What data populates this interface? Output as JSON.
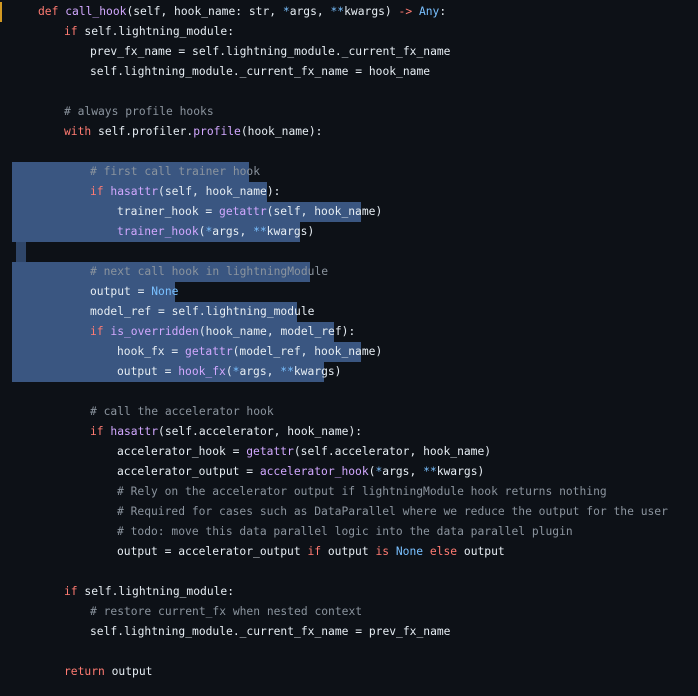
{
  "code": {
    "lines": [
      {
        "indent": 1,
        "tokens": [
          [
            "kw",
            "def "
          ],
          [
            "fn",
            "call_hook"
          ],
          [
            "pl",
            "(self, hook_name: str, "
          ],
          [
            "bi",
            "*"
          ],
          [
            "pl",
            "args, "
          ],
          [
            "bi",
            "**"
          ],
          [
            "pl",
            "kwargs) "
          ],
          [
            "kw",
            "-> "
          ],
          [
            "bi",
            "Any"
          ],
          [
            "pl",
            ":"
          ]
        ]
      },
      {
        "indent": 2,
        "tokens": [
          [
            "kw",
            "if "
          ],
          [
            "pl",
            "self.lightning_module:"
          ]
        ]
      },
      {
        "indent": 3,
        "tokens": [
          [
            "pl",
            "prev_fx_name = self.lightning_module._current_fx_name"
          ]
        ]
      },
      {
        "indent": 3,
        "tokens": [
          [
            "pl",
            "self.lightning_module._current_fx_name = hook_name"
          ]
        ]
      },
      {
        "indent": 0,
        "tokens": []
      },
      {
        "indent": 2,
        "tokens": [
          [
            "cm",
            "# always profile hooks"
          ]
        ]
      },
      {
        "indent": 2,
        "tokens": [
          [
            "kw",
            "with "
          ],
          [
            "pl",
            "self.profiler."
          ],
          [
            "fn",
            "profile"
          ],
          [
            "pl",
            "(hook_name):"
          ]
        ]
      },
      {
        "indent": 0,
        "tokens": []
      },
      {
        "indent": 3,
        "tokens": [
          [
            "cm",
            "# first call trainer hook"
          ]
        ]
      },
      {
        "indent": 3,
        "tokens": [
          [
            "kw",
            "if "
          ],
          [
            "fn",
            "hasattr"
          ],
          [
            "pl",
            "(self, hook_name):"
          ]
        ]
      },
      {
        "indent": 4,
        "tokens": [
          [
            "pl",
            "trainer_hook = "
          ],
          [
            "fn",
            "getattr"
          ],
          [
            "pl",
            "(self, hook_name)"
          ]
        ]
      },
      {
        "indent": 4,
        "tokens": [
          [
            "fn",
            "trainer_hook"
          ],
          [
            "pl",
            "("
          ],
          [
            "bi",
            "*"
          ],
          [
            "pl",
            "args, "
          ],
          [
            "bi",
            "**"
          ],
          [
            "pl",
            "kwargs)"
          ]
        ]
      },
      {
        "indent": 0,
        "tokens": []
      },
      {
        "indent": 3,
        "tokens": [
          [
            "cm",
            "# next call hook in lightningModule"
          ]
        ]
      },
      {
        "indent": 3,
        "tokens": [
          [
            "pl",
            "output = "
          ],
          [
            "cs",
            "None"
          ]
        ]
      },
      {
        "indent": 3,
        "tokens": [
          [
            "pl",
            "model_ref = self.lightning_module"
          ]
        ]
      },
      {
        "indent": 3,
        "tokens": [
          [
            "kw",
            "if "
          ],
          [
            "fn",
            "is_overridden"
          ],
          [
            "pl",
            "(hook_name, model_ref):"
          ]
        ]
      },
      {
        "indent": 4,
        "tokens": [
          [
            "pl",
            "hook_fx = "
          ],
          [
            "fn",
            "getattr"
          ],
          [
            "pl",
            "(model_ref, hook_name)"
          ]
        ]
      },
      {
        "indent": 4,
        "tokens": [
          [
            "pl",
            "output = "
          ],
          [
            "fn",
            "hook_fx"
          ],
          [
            "pl",
            "("
          ],
          [
            "bi",
            "*"
          ],
          [
            "pl",
            "args, "
          ],
          [
            "bi",
            "**"
          ],
          [
            "pl",
            "kwargs)"
          ]
        ]
      },
      {
        "indent": 0,
        "tokens": []
      },
      {
        "indent": 3,
        "tokens": [
          [
            "cm",
            "# call the accelerator hook"
          ]
        ]
      },
      {
        "indent": 3,
        "tokens": [
          [
            "kw",
            "if "
          ],
          [
            "fn",
            "hasattr"
          ],
          [
            "pl",
            "(self.accelerator, hook_name):"
          ]
        ]
      },
      {
        "indent": 4,
        "tokens": [
          [
            "pl",
            "accelerator_hook = "
          ],
          [
            "fn",
            "getattr"
          ],
          [
            "pl",
            "(self.accelerator, hook_name)"
          ]
        ]
      },
      {
        "indent": 4,
        "tokens": [
          [
            "pl",
            "accelerator_output = "
          ],
          [
            "fn",
            "accelerator_hook"
          ],
          [
            "pl",
            "("
          ],
          [
            "bi",
            "*"
          ],
          [
            "pl",
            "args, "
          ],
          [
            "bi",
            "**"
          ],
          [
            "pl",
            "kwargs)"
          ]
        ]
      },
      {
        "indent": 4,
        "tokens": [
          [
            "cm",
            "# Rely on the accelerator output if lightningModule hook returns nothing"
          ]
        ]
      },
      {
        "indent": 4,
        "tokens": [
          [
            "cm",
            "# Required for cases such as DataParallel where we reduce the output for the user"
          ]
        ]
      },
      {
        "indent": 4,
        "tokens": [
          [
            "cm",
            "# todo: move this data parallel logic into the data parallel plugin"
          ]
        ]
      },
      {
        "indent": 4,
        "tokens": [
          [
            "pl",
            "output = accelerator_output "
          ],
          [
            "kw",
            "if "
          ],
          [
            "pl",
            "output "
          ],
          [
            "kw",
            "is "
          ],
          [
            "cs",
            "None "
          ],
          [
            "kw",
            "else "
          ],
          [
            "pl",
            "output"
          ]
        ]
      },
      {
        "indent": 0,
        "tokens": []
      },
      {
        "indent": 2,
        "tokens": [
          [
            "kw",
            "if "
          ],
          [
            "pl",
            "self.lightning_module:"
          ]
        ]
      },
      {
        "indent": 3,
        "tokens": [
          [
            "cm",
            "# restore current_fx when nested context"
          ]
        ]
      },
      {
        "indent": 3,
        "tokens": [
          [
            "pl",
            "self.lightning_module._current_fx_name = prev_fx_name"
          ]
        ]
      },
      {
        "indent": 0,
        "tokens": []
      },
      {
        "indent": 2,
        "tokens": [
          [
            "kw",
            "return "
          ],
          [
            "pl",
            "output"
          ]
        ]
      }
    ]
  },
  "colors": {
    "background": "#0d1117",
    "keyword": "#ff7b72",
    "function": "#d2a8ff",
    "comment": "#8b949e",
    "builtin": "#79c0ff",
    "plain": "#e6edf3",
    "selection": "#3a5681"
  }
}
